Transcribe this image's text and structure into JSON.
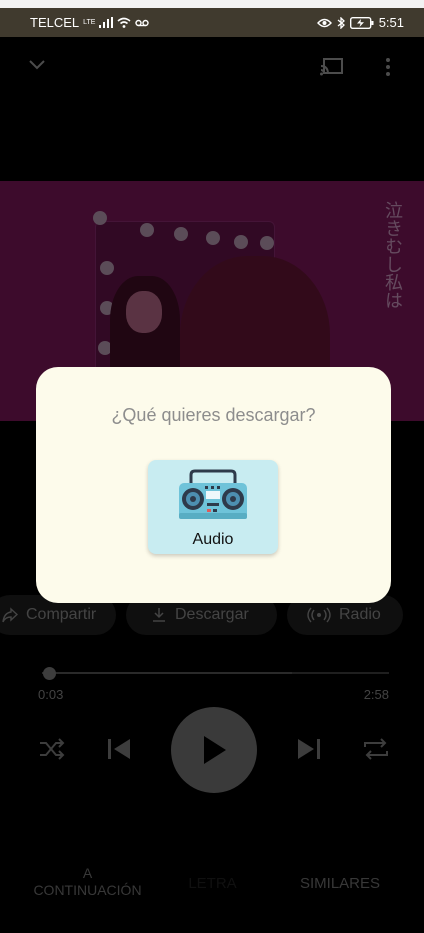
{
  "status_bar": {
    "carrier": "TELCEL",
    "network": "LTE",
    "time": "5:51"
  },
  "player": {
    "actions": {
      "share_label": "Compartir",
      "download_label": "Descargar",
      "radio_label": "Radio"
    },
    "progress": 0.02,
    "elapsed": "0:03",
    "duration": "2:58",
    "artwork_text": "泣きむし私は"
  },
  "tabs": [
    {
      "label": "A CONTINUACIÓN"
    },
    {
      "label": "LETRA"
    },
    {
      "label": "SIMILARES"
    }
  ],
  "dialog": {
    "title": "¿Qué quieres descargar?",
    "audio_label": "Audio"
  },
  "colors": {
    "dialog_bg": "#fdfbeb",
    "audio_card_bg": "#c8ecf1",
    "status_bar_bg": "#403a2e",
    "artwork_bg": "#6f1450"
  }
}
